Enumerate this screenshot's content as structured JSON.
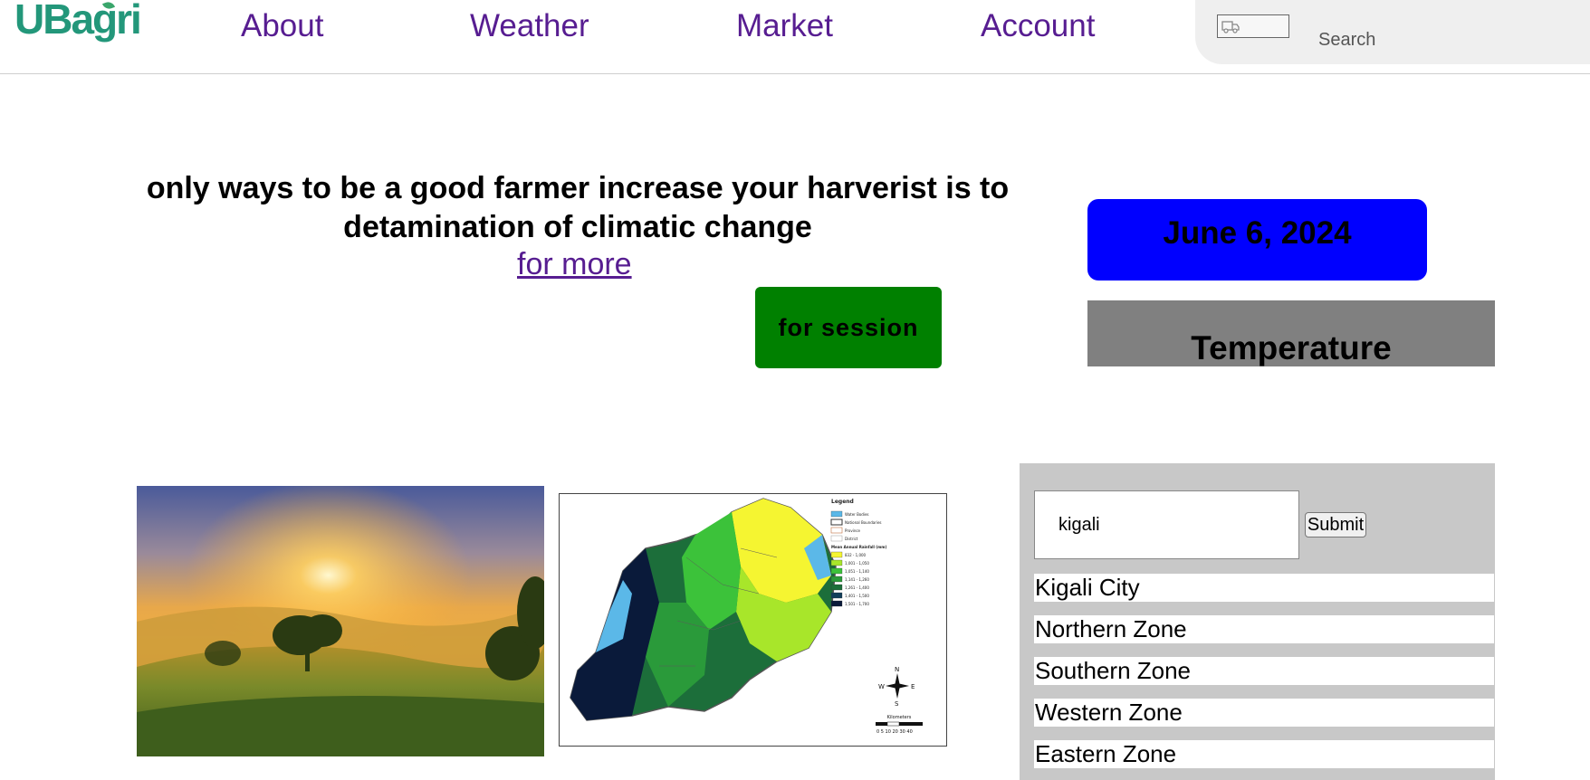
{
  "header": {
    "logo_text": "UBagri",
    "nav": [
      "About",
      "Weather",
      "Market",
      "Account"
    ],
    "search_placeholder": "Search"
  },
  "hero": {
    "slogan": "only ways to be a good farmer increase your harverist is to detamination of climatic change",
    "more_link": "for more",
    "session_button": "for session"
  },
  "widgets": {
    "date": "June 6, 2024",
    "temperature_label": "Temperature"
  },
  "location_panel": {
    "input_value": "kigali",
    "submit_label": "Submit",
    "zones": [
      "Kigali City",
      "Northern Zone",
      "Southern Zone",
      "Western Zone",
      "Eastern Zone"
    ]
  },
  "map": {
    "legend_title": "Legend",
    "legend_items": [
      "Water Bodies",
      "National Boundaries",
      "Province",
      "District",
      "Mean Annual Rainfall (mm)",
      "832 - 1,000",
      "1,001 - 1,050",
      "1,051 - 1,140",
      "1,141 - 1,260",
      "1,261 - 1,400",
      "1,401 - 1,500",
      "1,501 - 1,700"
    ],
    "compass": [
      "N",
      "W",
      "E",
      "S"
    ],
    "scale_label": "Kilometers",
    "scale_ticks": "0 5 10  20  30  40",
    "colors": {
      "water": "#5bb8e8",
      "rain_832_1000": "#f5f531",
      "rain_1001_1050": "#a8e62a",
      "rain_1051_1140": "#3cc23a",
      "rain_1141_1260": "#2a9a3a",
      "rain_1261_1400": "#1c6e3a",
      "rain_1401_1500": "#123e5a",
      "rain_1501_1700": "#0a1a3a"
    }
  },
  "colors": {
    "nav_link": "#571d91",
    "logo": "#23977a",
    "date_box": "#0000ff",
    "temp_box": "#808080",
    "session_button": "#008000"
  }
}
